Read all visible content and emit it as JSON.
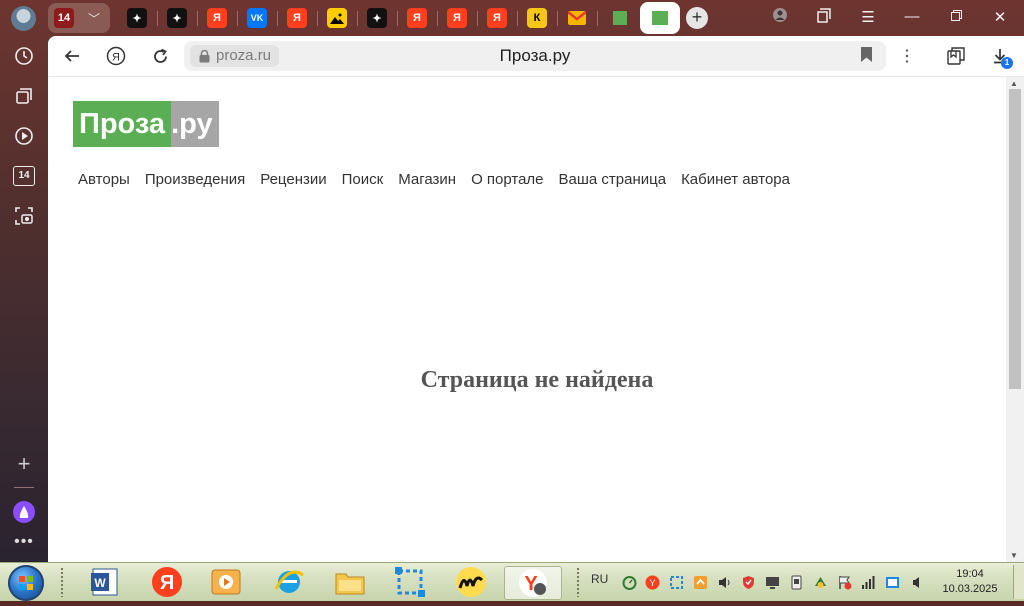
{
  "tabs": {
    "group_badge": "14",
    "count_label": "14",
    "tab_letters": [
      "Я",
      "Я",
      "Я",
      "Я",
      "Я",
      "К"
    ],
    "vk_label": "VK",
    "active_tab_favicon_color": "#5cae54"
  },
  "toolbar": {
    "domain": "proza.ru",
    "page_title": "Проза.ру",
    "downloads_badge": "1"
  },
  "page": {
    "logo_main": "Проза",
    "logo_dot": ".",
    "logo_suffix": "ру",
    "nav": [
      "Авторы",
      "Произведения",
      "Рецензии",
      "Поиск",
      "Магазин",
      "О портале",
      "Ваша страница",
      "Кабинет автора"
    ],
    "message": "Страница не найдена"
  },
  "taskbar": {
    "lang": "RU",
    "time": "19:04",
    "date": "10.03.2025"
  },
  "colors": {
    "brand_green": "#5cae54",
    "brand_gray": "#a6a6a6",
    "yandex_red": "#fc3f1d"
  }
}
